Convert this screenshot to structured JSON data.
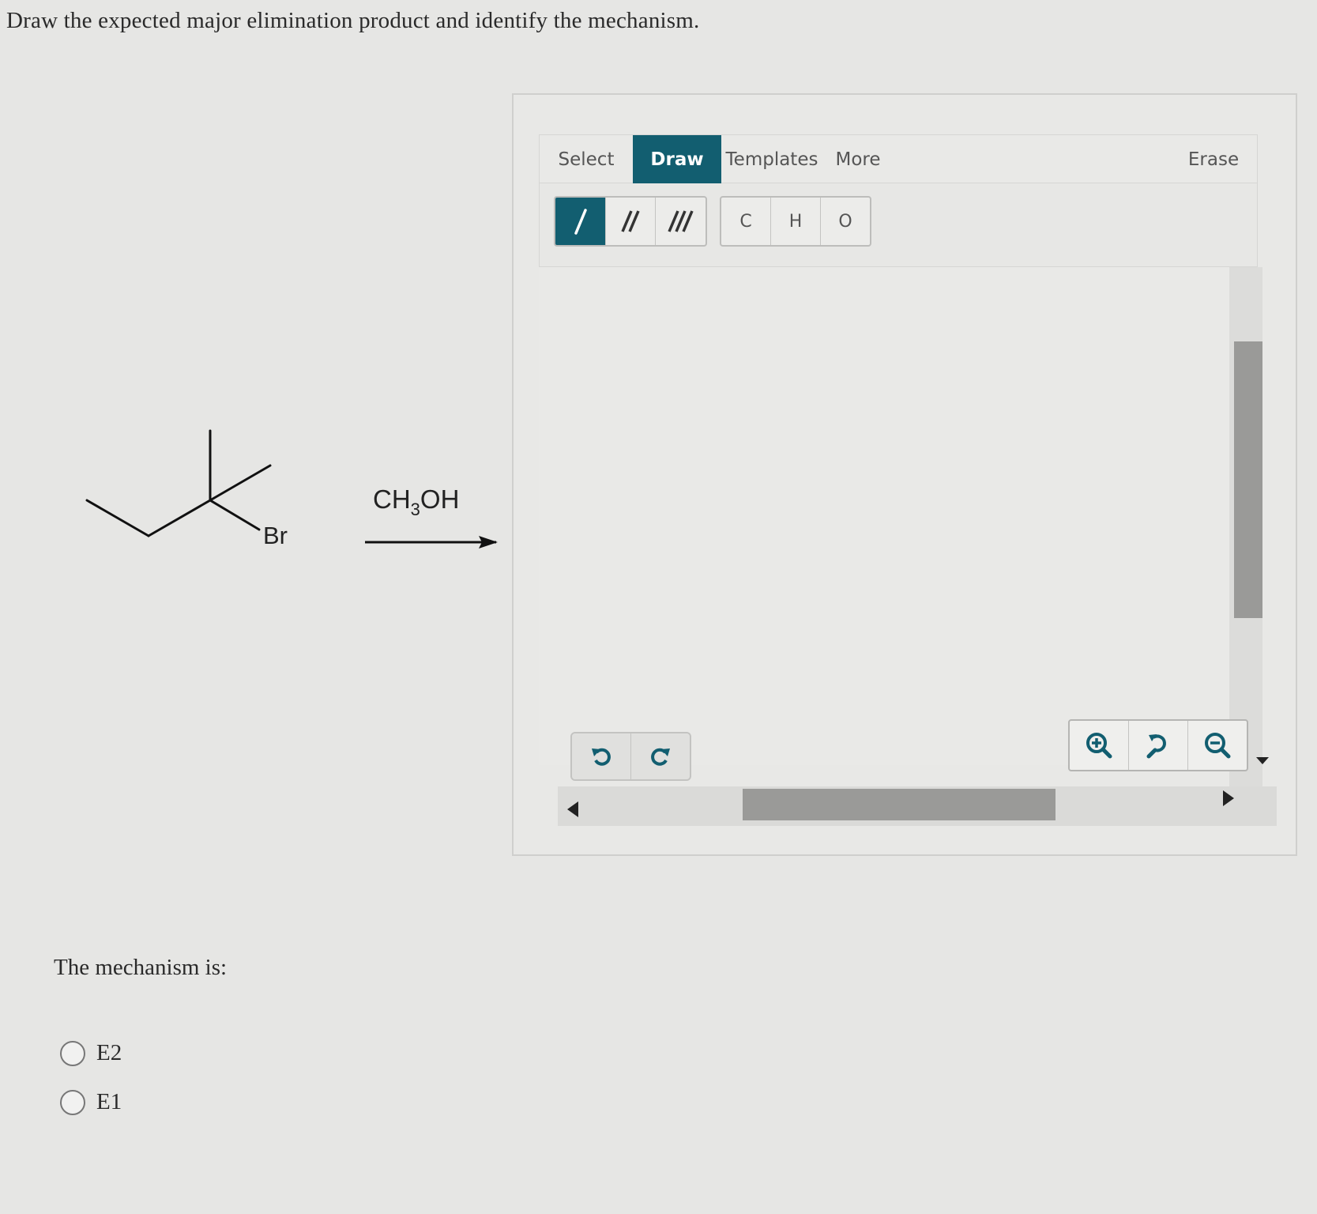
{
  "question": {
    "text": "Draw the expected major elimination product and identify the mechanism."
  },
  "reaction": {
    "leaving_group": "Br",
    "reagent": {
      "main": "CH",
      "sub": "3",
      "tail": "OH"
    }
  },
  "mechanism": {
    "label": "The mechanism is:",
    "options": [
      {
        "label": "E2",
        "selected": false
      },
      {
        "label": "E1",
        "selected": false
      }
    ]
  },
  "editor": {
    "tabs": [
      {
        "label": "Select",
        "active": false
      },
      {
        "label": "Draw",
        "active": true
      },
      {
        "label": "Templates",
        "active": false
      },
      {
        "label": "More",
        "active": false
      }
    ],
    "erase_label": "Erase",
    "bond_tools": [
      {
        "name": "single-bond",
        "active": true
      },
      {
        "name": "double-bond",
        "active": false
      },
      {
        "name": "triple-bond",
        "active": false
      }
    ],
    "atoms": [
      "C",
      "H",
      "O"
    ],
    "history_icons": [
      "undo-icon",
      "redo-icon"
    ],
    "zoom_icons": [
      "zoom-in-icon",
      "zoom-reset-icon",
      "zoom-out-icon"
    ],
    "accent_color": "#125e70"
  }
}
